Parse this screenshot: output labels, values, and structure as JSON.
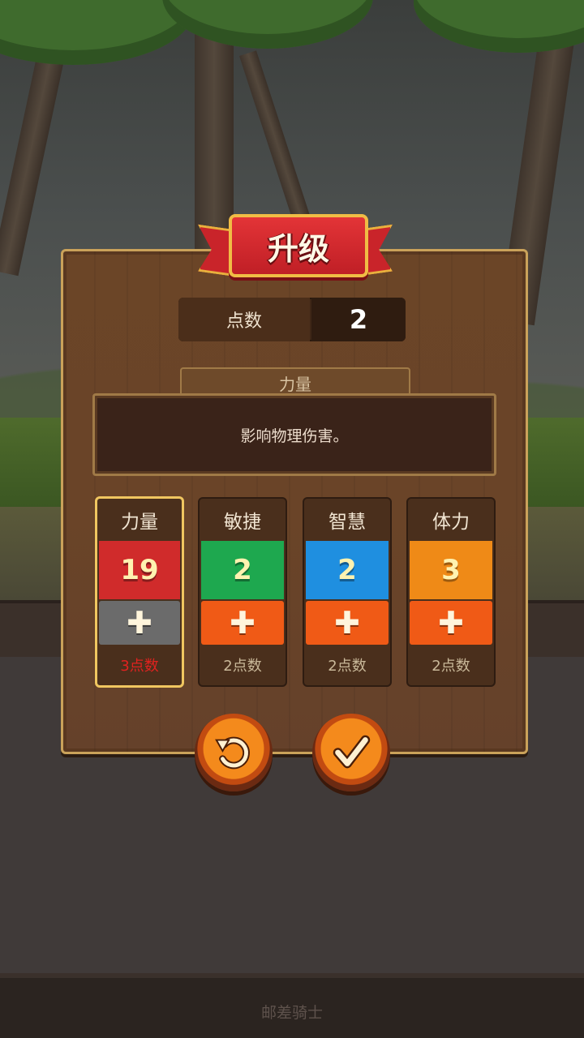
{
  "dialog": {
    "title": "升级"
  },
  "points": {
    "label": "点数",
    "value": "2"
  },
  "description": {
    "header": "力量",
    "text": "影响物理伤害。"
  },
  "stats": [
    {
      "name": "力量",
      "value": "19",
      "cost": "3点数",
      "color": "#d02b2b",
      "plus_color": "#6b6b6b",
      "selected": true,
      "affordable": false
    },
    {
      "name": "敏捷",
      "value": "2",
      "cost": "2点数",
      "color": "#1ea84f",
      "plus_color": "#f05a16",
      "selected": false,
      "affordable": true
    },
    {
      "name": "智慧",
      "value": "2",
      "cost": "2点数",
      "color": "#1f8fe0",
      "plus_color": "#f05a16",
      "selected": false,
      "affordable": true
    },
    {
      "name": "体力",
      "value": "3",
      "cost": "2点数",
      "color": "#ef8a17",
      "plus_color": "#f05a16",
      "selected": false,
      "affordable": true
    }
  ],
  "buttons": {
    "reset_icon": "undo-icon",
    "confirm_icon": "checkmark-icon"
  },
  "footer": {
    "text": "邮差骑士"
  }
}
